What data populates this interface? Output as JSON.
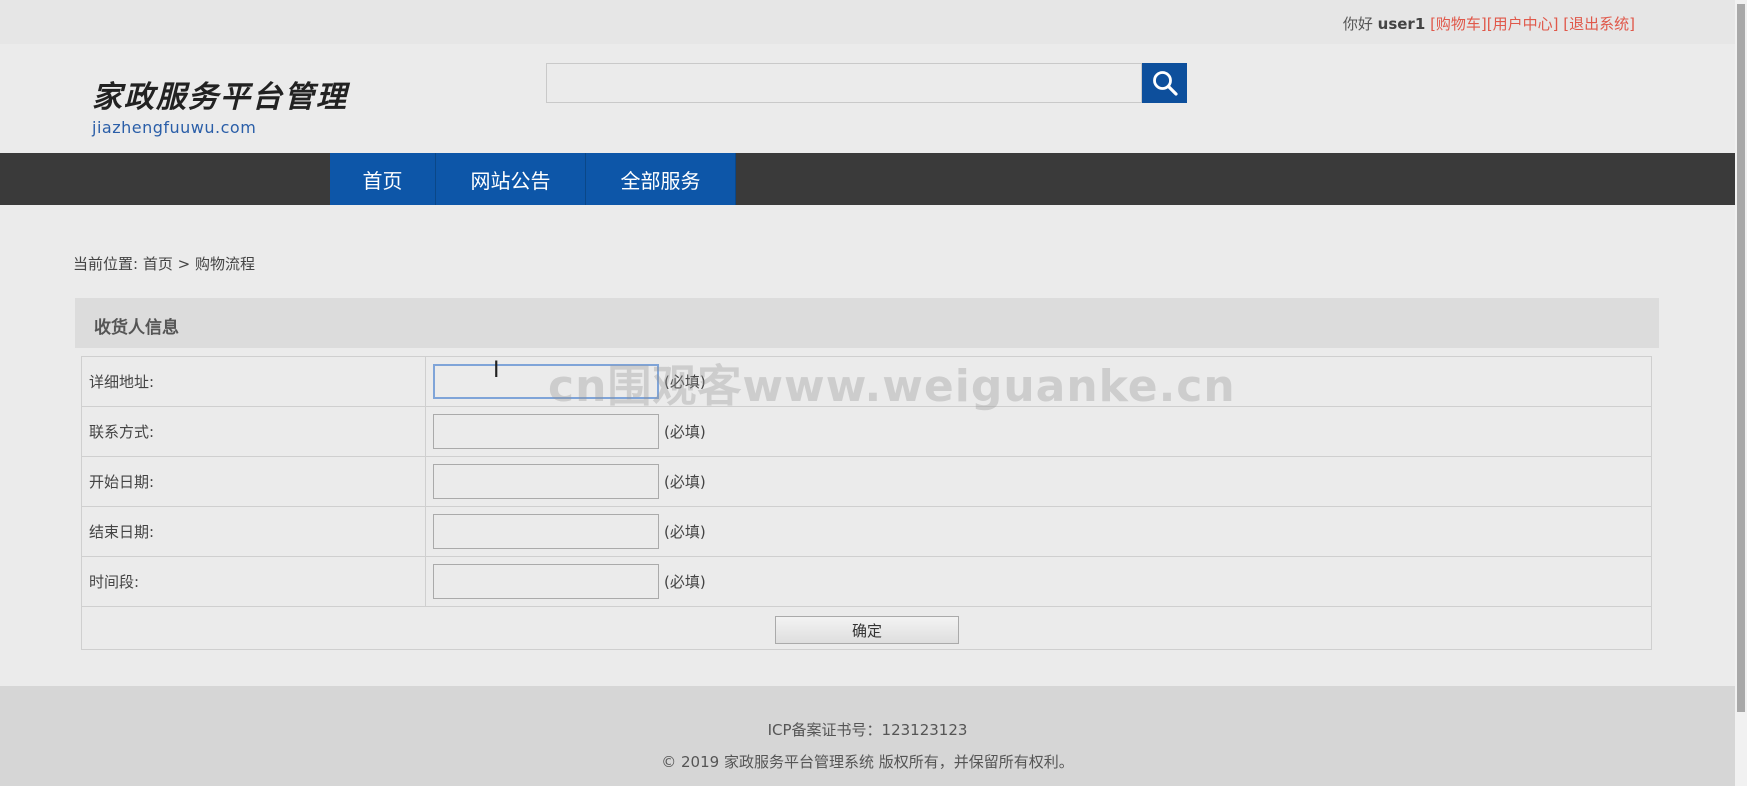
{
  "topbar": {
    "greeting": "你好",
    "username": "user1",
    "links": [
      "[购物车]",
      "[用户中心]",
      "[退出系统]"
    ]
  },
  "header": {
    "logo_cn": "家政服务平台管理",
    "logo_en": "jiazhengfuuwu.com",
    "search": {
      "value": "",
      "placeholder": ""
    }
  },
  "nav": {
    "items": [
      "首页",
      "网站公告",
      "全部服务"
    ]
  },
  "breadcrumb": {
    "prefix": "当前位置:",
    "home": "首页",
    "arrow": ">",
    "current": "购物流程"
  },
  "panel": {
    "title": "收货人信息"
  },
  "form": {
    "rows": [
      {
        "label": "详细地址:",
        "value": "",
        "required": "(必填)"
      },
      {
        "label": "联系方式:",
        "value": "",
        "required": "(必填)"
      },
      {
        "label": "开始日期:",
        "value": "",
        "required": "(必填)"
      },
      {
        "label": "结束日期:",
        "value": "",
        "required": "(必填)"
      },
      {
        "label": "时间段:",
        "value": "",
        "required": "(必填)"
      }
    ],
    "submit_label": "确定"
  },
  "footer": {
    "icp": "ICP备案证书号：123123123",
    "copyright": "© 2019 家政服务平台管理系统 版权所有，并保留所有权利。"
  },
  "watermark": "cn围观客www.weiguanke.cn",
  "icons": {
    "search": "search-icon",
    "cursor": "text-cursor-icon"
  },
  "colors": {
    "nav_active": "#0d56a8",
    "nav_bg": "#3a3a3a",
    "link": "#e0584a",
    "search_btn": "#0d4f9c"
  }
}
